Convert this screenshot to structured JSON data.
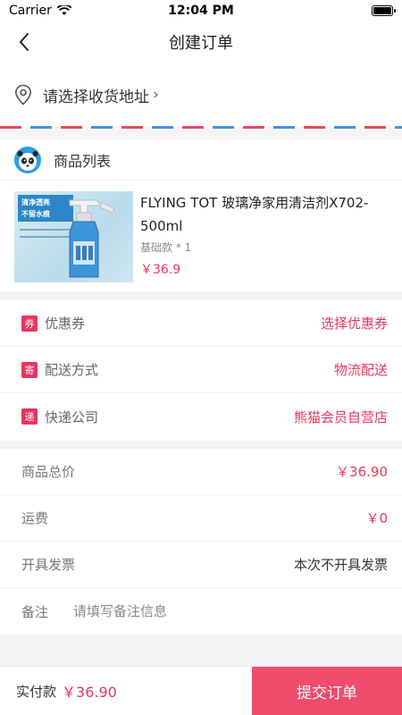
{
  "status_bar": {
    "carrier": "Carrier",
    "time": "12:04 PM"
  },
  "nav": {
    "title": "创建订单"
  },
  "address": {
    "placeholder": "请选择收货地址",
    "arrow": "›"
  },
  "goods": {
    "section_title": "商品列表",
    "items": [
      {
        "name": "FLYING TOT 玻璃净家用清洁剂X702-500ml",
        "spec": "基础款 * 1",
        "price": "￥36.9",
        "thumb_text": "清净透亮\n不留水痕"
      }
    ]
  },
  "options": [
    {
      "badge": "券",
      "label": "优惠券",
      "value": "选择优惠券"
    },
    {
      "badge": "寄",
      "label": "配送方式",
      "value": "物流配送"
    },
    {
      "badge": "递",
      "label": "快递公司",
      "value": "熊猫会员自营店"
    }
  ],
  "summary": {
    "total_label": "商品总价",
    "total_value": "￥36.90",
    "shipping_label": "运费",
    "shipping_value": "￥0",
    "invoice_label": "开具发票",
    "invoice_value": "本次不开具发票",
    "remark_label": "备注",
    "remark_placeholder": "请填写备注信息"
  },
  "bottom": {
    "pay_label": "实付款",
    "pay_amount": "￥36.90",
    "submit_label": "提交订单"
  },
  "colors": {
    "accent": "#e8365d",
    "button": "#ef4d6b",
    "airmail_red": "#e84a5f",
    "airmail_blue": "#4a90e2"
  },
  "icons": {
    "back": "chevron-left-icon",
    "location": "location-pin-icon",
    "shop": "panda-avatar-icon"
  }
}
